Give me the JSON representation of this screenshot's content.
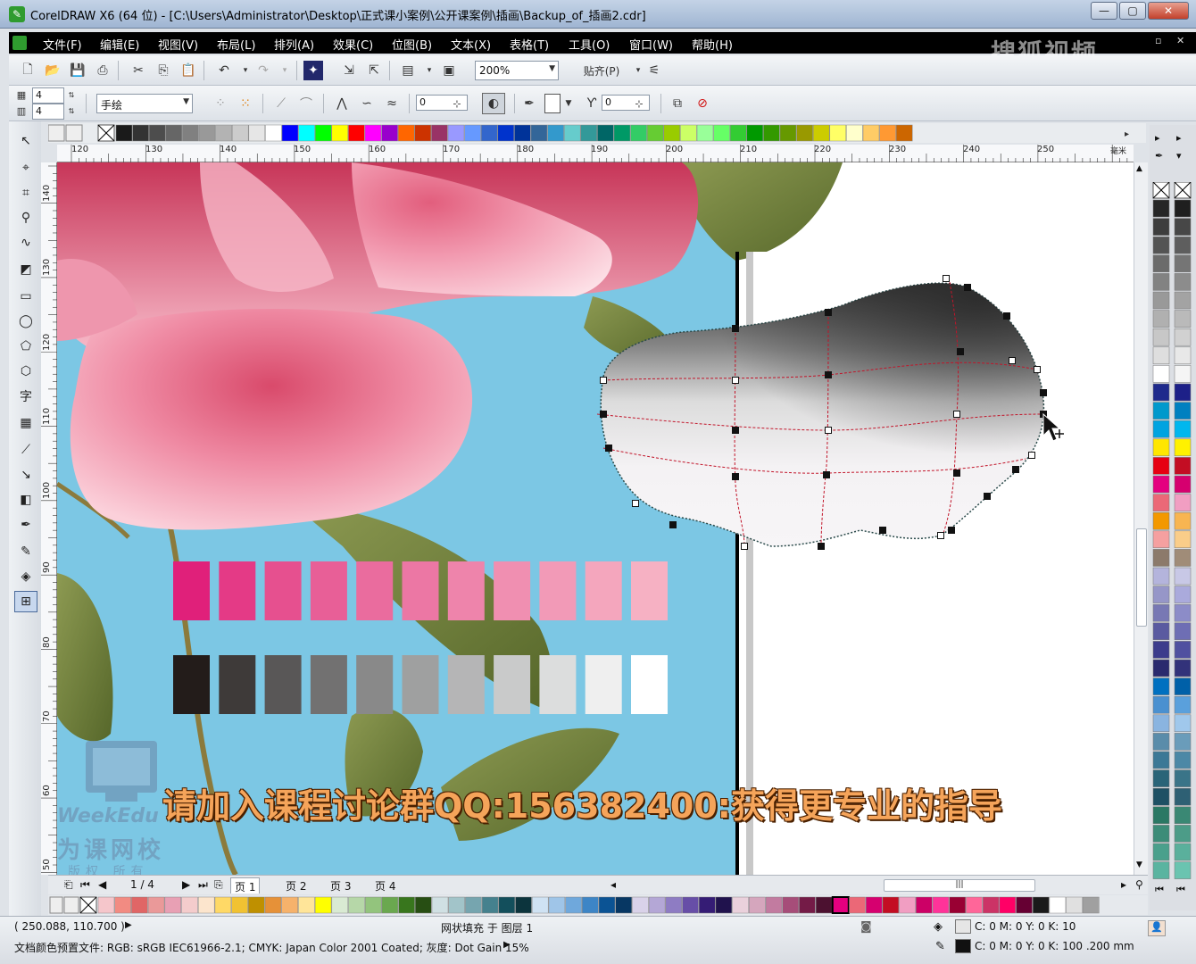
{
  "window": {
    "title": "CorelDRAW X6 (64 位) - [C:\\Users\\Administrator\\Desktop\\正式课小案例\\公开课案例\\插画\\Backup_of_插画2.cdr]",
    "minimize": "—",
    "maximize": "▢",
    "close": "✕"
  },
  "menu": [
    "文件(F)",
    "编辑(E)",
    "视图(V)",
    "布局(L)",
    "排列(A)",
    "效果(C)",
    "位图(B)",
    "文本(X)",
    "表格(T)",
    "工具(O)",
    "窗口(W)",
    "帮助(H)"
  ],
  "watermark_top": "搜狐视频",
  "standard_toolbar": {
    "zoom_value": "200%",
    "snap_label": "贴齐(P)"
  },
  "property_bar": {
    "grid_rows": "4",
    "grid_cols": "4",
    "tool_mode": "手绘",
    "curve_smoothing": "0",
    "rotation": "0"
  },
  "ruler": {
    "unit": "毫米",
    "h_labels": [
      "120",
      "130",
      "140",
      "150",
      "160",
      "170",
      "180",
      "190",
      "200",
      "210",
      "220",
      "230",
      "240",
      "250"
    ],
    "v_labels": [
      "140",
      "130",
      "120",
      "110",
      "100",
      "90",
      "80",
      "70",
      "60",
      "50"
    ]
  },
  "palette": {
    "top": [
      "#1a1a1a",
      "#333333",
      "#4d4d4d",
      "#666666",
      "#808080",
      "#999999",
      "#b3b3b3",
      "#cccccc",
      "#e6e6e6",
      "#ffffff",
      "#0000ff",
      "#00ffff",
      "#00ff00",
      "#ffff00",
      "#ff0000",
      "#ff00ff",
      "#9900cc",
      "#ff6600",
      "#cc3300",
      "#993366",
      "#9999ff",
      "#6699ff",
      "#3366cc",
      "#0033cc",
      "#003399",
      "#336699",
      "#3399cc",
      "#66cccc",
      "#339999",
      "#006666",
      "#009966",
      "#33cc66",
      "#66cc33",
      "#99cc00",
      "#ccff66",
      "#99ff99",
      "#66ff66",
      "#33cc33",
      "#009900",
      "#339900",
      "#669900",
      "#999900",
      "#cccc00",
      "#ffff66",
      "#ffffcc",
      "#ffcc66",
      "#ff9933",
      "#cc6600"
    ],
    "right_col1": [
      "#262626",
      "#3d3d3d",
      "#545454",
      "#6b6b6b",
      "#828282",
      "#999999",
      "#b0b0b0",
      "#c7c7c7",
      "#dedede",
      "#ffffff",
      "#1f2a8c",
      "#0099cc",
      "#00a3e0",
      "#ffe600",
      "#e60012",
      "#e4007f",
      "#eb6877",
      "#f39800",
      "#f5a0a0",
      "#8c7a6b",
      "#b4b4dc",
      "#9696c8",
      "#7878b4",
      "#5a5aa0",
      "#3c3c8c",
      "#2a2a6e",
      "#0070c0",
      "#4a90d0",
      "#8ab4e0",
      "#5a8caa",
      "#3c7896",
      "#2a6478",
      "#1e5064",
      "#2a7864",
      "#3c8c78",
      "#4aa08c",
      "#5ab4a0"
    ],
    "right_col2": [
      "#1f1f1f",
      "#474747",
      "#5e5e5e",
      "#757575",
      "#8c8c8c",
      "#a3a3a3",
      "#bababa",
      "#d1d1d1",
      "#e8e8e8",
      "#f5f5f5",
      "#1d2088",
      "#0080c0",
      "#00b7ee",
      "#fff100",
      "#c30d23",
      "#d6006f",
      "#f19ec2",
      "#f8b551",
      "#facd89",
      "#a08c78",
      "#c8c8e6",
      "#aaaadc",
      "#8c8cc8",
      "#6e6eb4",
      "#5050a0",
      "#32327a",
      "#0060a8",
      "#5aa0dc",
      "#a0c8ec",
      "#6a9cba",
      "#4c88a6",
      "#3a7488",
      "#2e6074",
      "#3a8874",
      "#4c9c88",
      "#5ab09c",
      "#6ac4b0"
    ],
    "bottom": [
      "#f5c6cb",
      "#f28b82",
      "#e06666",
      "#ea9999",
      "#e8a0b4",
      "#f4cccc",
      "#fce5cd",
      "#ffd966",
      "#f1c232",
      "#bf9000",
      "#e69138",
      "#f6b26b",
      "#ffe599",
      "#ffff00",
      "#d9ead3",
      "#b6d7a8",
      "#93c47d",
      "#6aa84f",
      "#38761d",
      "#274e13",
      "#d0e0e3",
      "#a2c4c9",
      "#76a5af",
      "#45818e",
      "#134f5c",
      "#0c343d",
      "#cfe2f3",
      "#9fc5e8",
      "#6fa8dc",
      "#3d85c6",
      "#0b5394",
      "#073763",
      "#d9d2e9",
      "#b4a7d6",
      "#8e7cc3",
      "#674ea7",
      "#351c75",
      "#20124d",
      "#ead1dc",
      "#d5a6bd",
      "#c27ba0",
      "#a64d79",
      "#741b47",
      "#4c1130",
      "#e4007f",
      "#eb6877",
      "#d6006f",
      "#c30d23",
      "#f19ec2",
      "#cc0066",
      "#ff3399",
      "#990033",
      "#ff6699",
      "#cc3366",
      "#ff0066",
      "#660033",
      "#1a1a1a",
      "#ffffff",
      "#e0e0e0",
      "#a0a0a0"
    ]
  },
  "page_nav": {
    "counter": "1 / 4",
    "tabs": [
      "页 1",
      "页 2",
      "页 3",
      "页 4"
    ]
  },
  "subtitle": "请加入课程讨论群QQ:156382400:获得更专业的指导",
  "logo_text": {
    "line1": "WeekEdu",
    "line2": "为课网校",
    "line3": "版权 所有"
  },
  "status": {
    "coords": "( 250.088, 110.700 )",
    "object_info": "网状填充 于 图层 1",
    "fill_info": "C: 0 M: 0 Y: 0 K: 10",
    "outline_info": "C: 0 M: 0 Y: 0 K: 100  .200 mm",
    "color_profile": "文档颜色预置文件: RGB: sRGB IEC61966-2.1; CMYK: Japan Color 2001 Coated; 灰度: Dot Gain 15%"
  },
  "swatches": {
    "pink": [
      "#e0207a",
      "#e43a86",
      "#e6508f",
      "#e85f97",
      "#ea6c9e",
      "#ec77a4",
      "#ee84ab",
      "#f08fb1",
      "#f29ab7",
      "#f4a6bd",
      "#f6b1c3"
    ],
    "gray": [
      "#231c1a",
      "#3e3a39",
      "#595757",
      "#727171",
      "#898989",
      "#9fa0a0",
      "#b5b5b6",
      "#c9caca",
      "#dcdddd",
      "#efefef",
      "#ffffff"
    ]
  },
  "colors": {
    "sky": "#7cc7e4",
    "leaf": "#6b7c3a",
    "mesh_red": "#d0121b"
  }
}
